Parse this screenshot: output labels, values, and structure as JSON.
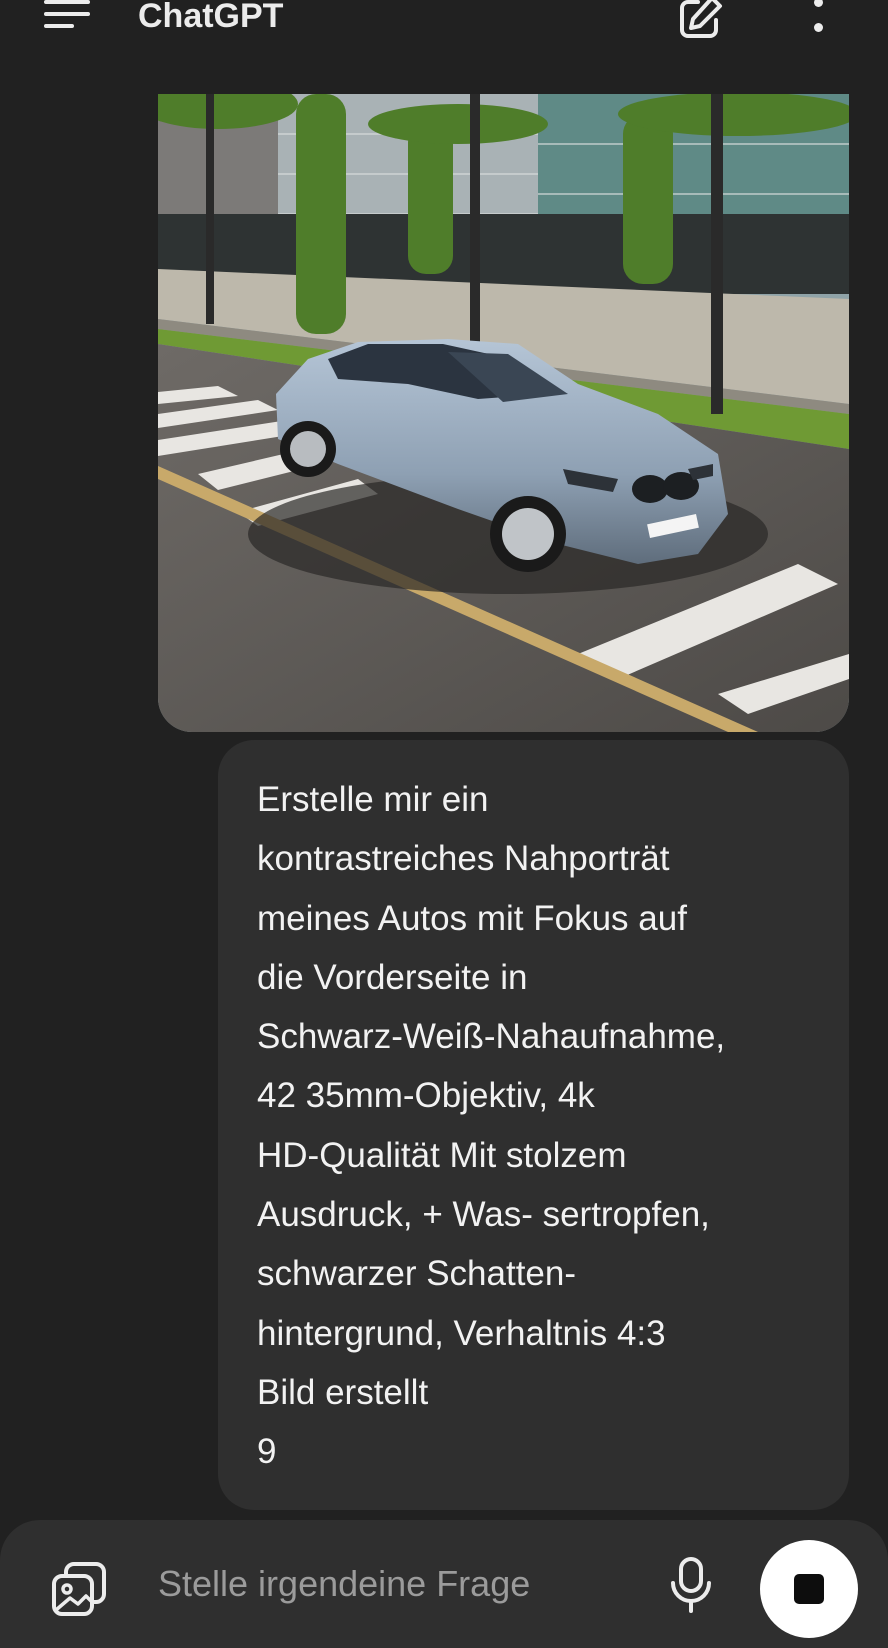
{
  "header": {
    "title": "ChatGPT",
    "menu_icon": "hamburger-menu-icon",
    "new_chat_icon": "edit-pencil-icon",
    "more_icon": "vertical-dots-icon"
  },
  "message": {
    "attachment_icon": "photo-attachment",
    "text": "Erstelle mir ein\nkontrastreiches Nahporträt\nmeines Autos mit Fokus auf\ndie Vorderseite in\nSchwarz-Weiß-Nahaufnahme,\n42 35mm-Objektiv, 4k\nHD-Qualität Mit stolzem\nAusdruck, + Was- sertropfen,\nschwarzer Schatten-\nhintergrund, Verhaltnis 4:3\nBild erstellt\n9"
  },
  "composer": {
    "placeholder": "Stelle irgendeine Frage",
    "attach_icon": "image-gallery-icon",
    "mic_icon": "microphone-icon",
    "stop_icon": "stop-square-icon"
  },
  "colors": {
    "background": "#212121",
    "bubble": "#2f2f2f",
    "text": "#ececec",
    "placeholder": "#9b9b9b"
  }
}
